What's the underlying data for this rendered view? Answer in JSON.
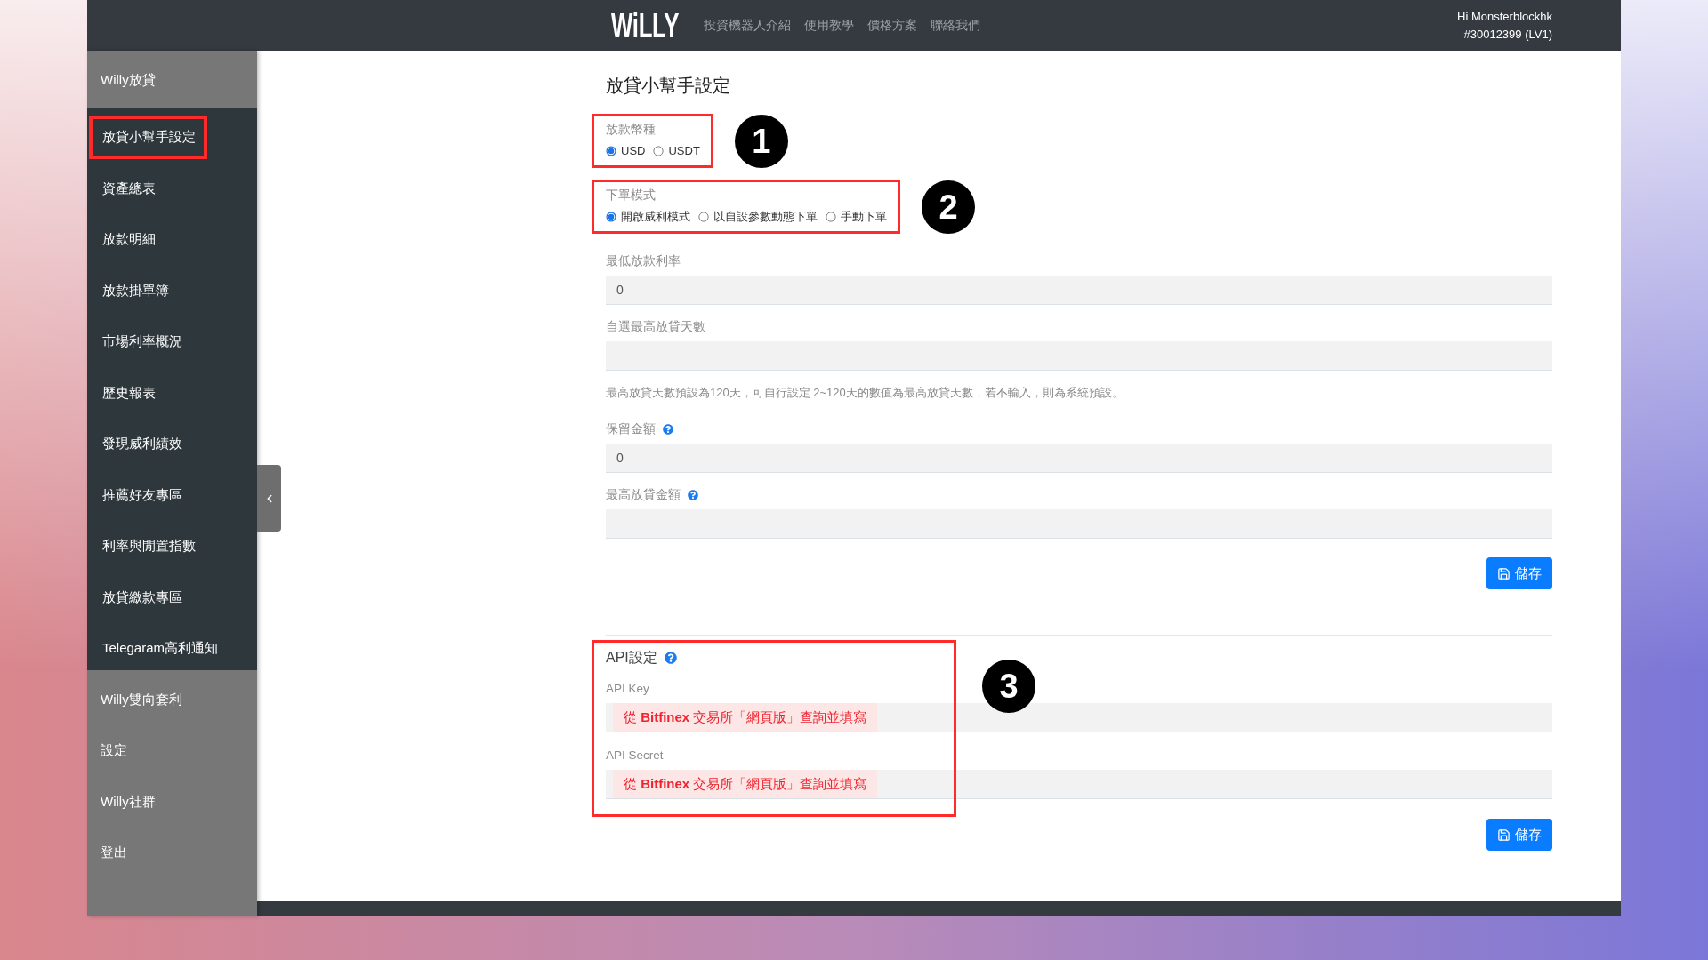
{
  "header": {
    "logo": "WiLLY",
    "nav": [
      "投資機器人介紹",
      "使用教學",
      "價格方案",
      "聯絡我們"
    ],
    "user": {
      "greeting": "Hi Monsterblockhk",
      "account": "#30012399 (LV1)"
    }
  },
  "sidebar": {
    "items": [
      {
        "label": "Willy放貸",
        "children": [
          {
            "label": "放貸小幫手設定",
            "highlighted": true
          },
          {
            "label": "資產總表",
            "highlighted": false
          },
          {
            "label": "放款明細",
            "highlighted": false
          },
          {
            "label": "放款掛單簿",
            "highlighted": false
          },
          {
            "label": "市場利率概況",
            "highlighted": false
          },
          {
            "label": "歷史報表",
            "highlighted": false
          },
          {
            "label": "發現威利績效",
            "highlighted": false
          },
          {
            "label": "推薦好友專區",
            "highlighted": false
          },
          {
            "label": "利率與閒置指數",
            "highlighted": false
          },
          {
            "label": "放貸繳款專區",
            "highlighted": false
          },
          {
            "label": "Telegaram高利通知",
            "highlighted": false
          }
        ]
      },
      {
        "label": "Willy雙向套利"
      },
      {
        "label": "設定"
      },
      {
        "label": "Willy社群"
      },
      {
        "label": "登出"
      }
    ]
  },
  "settings": {
    "title": "放貸小幫手設定",
    "fields": [
      {
        "kind": "radio",
        "label": "放款幣種",
        "highlighted": true,
        "marker": "1",
        "options": [
          {
            "label": "USD",
            "selected": true
          },
          {
            "label": "USDT",
            "selected": false
          }
        ]
      },
      {
        "kind": "radio",
        "label": "下單模式",
        "highlighted": true,
        "marker": "2",
        "options": [
          {
            "label": "開啟威利模式",
            "selected": true
          },
          {
            "label": "以自設參數動態下單",
            "selected": false
          },
          {
            "label": "手動下單",
            "selected": false
          }
        ]
      },
      {
        "kind": "input",
        "label": "最低放款利率",
        "help": false,
        "value": "0"
      },
      {
        "kind": "input",
        "label": "自選最高放貸天數",
        "help": false
      },
      {
        "kind": "note",
        "text": "最高放貸天數預設為120天，可自行設定 2~120天的數值為最高放貸天數，若不輸入，則為系統預設。"
      },
      {
        "kind": "input",
        "label": "保留金額",
        "help": true,
        "value": "0"
      },
      {
        "kind": "input",
        "label": "最高放貸金額",
        "help": true
      }
    ],
    "save": "儲存"
  },
  "api": {
    "title": "API設定",
    "help": true,
    "highlighted": true,
    "marker": "3",
    "fields": [
      {
        "label": "API Key",
        "hint": "從 **Bitfinex** 交易所「網頁版」查詢並填寫"
      },
      {
        "label": "API Secret",
        "hint": "從 **Bitfinex** 交易所「網頁版」查詢並填寫"
      }
    ],
    "save": "儲存"
  }
}
